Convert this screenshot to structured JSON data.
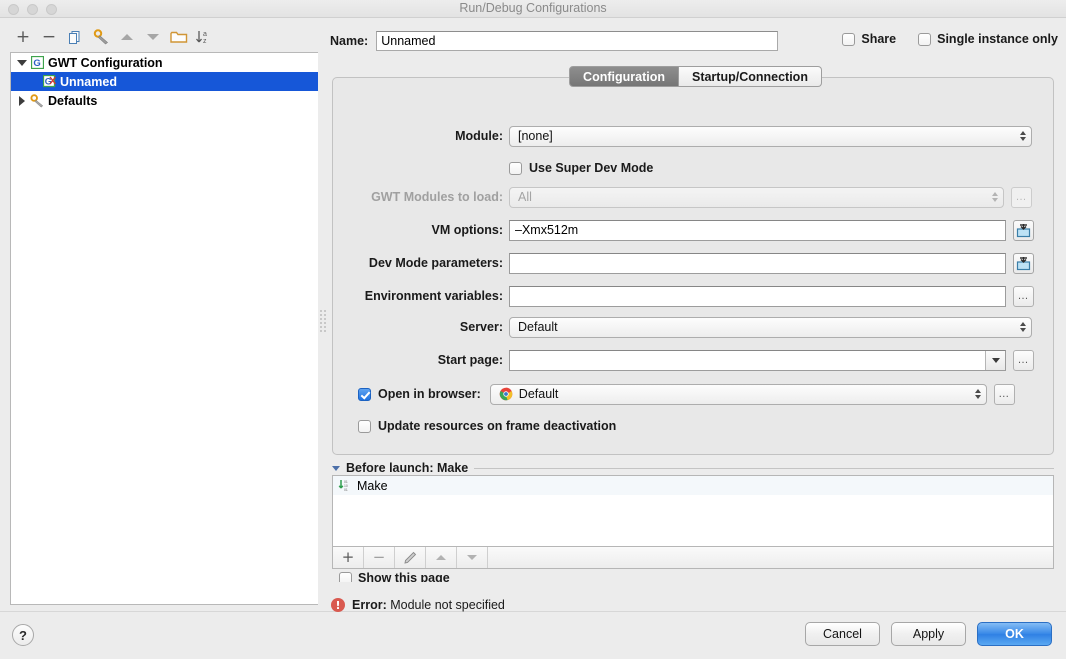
{
  "window": {
    "title": "Run/Debug Configurations",
    "traffic_lights": [
      "close",
      "minimize",
      "maximize"
    ]
  },
  "toolbar": {
    "buttons": [
      {
        "name": "add",
        "icon": "plus-icon",
        "label": "+"
      },
      {
        "name": "remove",
        "icon": "minus-icon",
        "label": "−"
      },
      {
        "name": "copy",
        "icon": "copy-icon",
        "label": ""
      },
      {
        "name": "edit-templates",
        "icon": "wrench-icon",
        "label": ""
      },
      {
        "name": "move-up",
        "icon": "arrow-up-icon",
        "label": ""
      },
      {
        "name": "move-down",
        "icon": "arrow-down-icon",
        "label": ""
      },
      {
        "name": "new-folder",
        "icon": "folder-icon",
        "label": ""
      },
      {
        "name": "sort-alphabetically",
        "icon": "sort-az-icon",
        "label": ""
      }
    ]
  },
  "tree": {
    "items": [
      {
        "label": "GWT Configuration",
        "icon": "gwt-icon",
        "expanded": true,
        "level": 0,
        "selected": false
      },
      {
        "label": "Unnamed",
        "icon": "gwt-run-icon",
        "expanded": null,
        "level": 1,
        "selected": true
      },
      {
        "label": "Defaults",
        "icon": "wrench-icon",
        "expanded": false,
        "level": 0,
        "selected": false
      }
    ]
  },
  "header": {
    "name_label": "Name:",
    "name_value": "Unnamed",
    "name_placeholder": "",
    "share_label": "Share",
    "share_checked": false,
    "single_instance_label": "Single instance only",
    "single_instance_checked": false
  },
  "tabs": [
    {
      "label": "Configuration",
      "active": true
    },
    {
      "label": "Startup/Connection",
      "active": false
    }
  ],
  "form": {
    "module": {
      "label": "Module:",
      "value": "[none]",
      "disabled": false
    },
    "super_dev_mode": {
      "label": "Use Super Dev Mode",
      "checked": false
    },
    "gwt_modules": {
      "label": "GWT Modules to load:",
      "value": "All",
      "disabled": true,
      "ellipsis": "…"
    },
    "vm_options": {
      "label": "VM options:",
      "value": "–Xmx512m",
      "macro_icon": "expand-macro-icon"
    },
    "dev_mode_parameters": {
      "label": "Dev Mode parameters:",
      "value": "",
      "macro_icon": "expand-macro-icon"
    },
    "environment_variables": {
      "label": "Environment variables:",
      "value": "",
      "ellipsis": "…"
    },
    "server": {
      "label": "Server:",
      "value": "Default"
    },
    "start_page": {
      "label": "Start page:",
      "value": "",
      "ellipsis": "…"
    },
    "open_in_browser": {
      "label": "Open in browser:",
      "checked": true,
      "value": "Default",
      "browser_icon": "chrome-icon",
      "ellipsis": "…"
    },
    "update_resources": {
      "label": "Update resources on frame deactivation",
      "checked": false
    }
  },
  "before_launch": {
    "title": "Before launch: Make",
    "items": [
      {
        "label": "Make",
        "icon": "make-icon"
      }
    ],
    "toolbar": [
      {
        "name": "add-task",
        "icon": "plus-icon",
        "label": "+"
      },
      {
        "name": "remove-task",
        "icon": "minus-icon",
        "label": "−"
      },
      {
        "name": "edit-task",
        "icon": "pencil-icon",
        "label": ""
      },
      {
        "name": "move-task-up",
        "icon": "arrow-up-icon",
        "label": ""
      },
      {
        "name": "move-task-down",
        "icon": "arrow-down-icon",
        "label": ""
      }
    ],
    "show_this_page": {
      "label": "Show this page",
      "checked": false
    }
  },
  "status": {
    "error_icon": "error-icon",
    "error_prefix": "Error:",
    "error_message": "Module not specified"
  },
  "footer": {
    "help_label": "?",
    "buttons": [
      {
        "label": "Cancel",
        "default": false
      },
      {
        "label": "Apply",
        "default": false
      },
      {
        "label": "OK",
        "default": true
      }
    ]
  },
  "colors": {
    "selection_blue": "#1657d8",
    "default_button_blue": "#2f80e4",
    "error_red": "#d9594f",
    "window_background": "#ececec"
  }
}
